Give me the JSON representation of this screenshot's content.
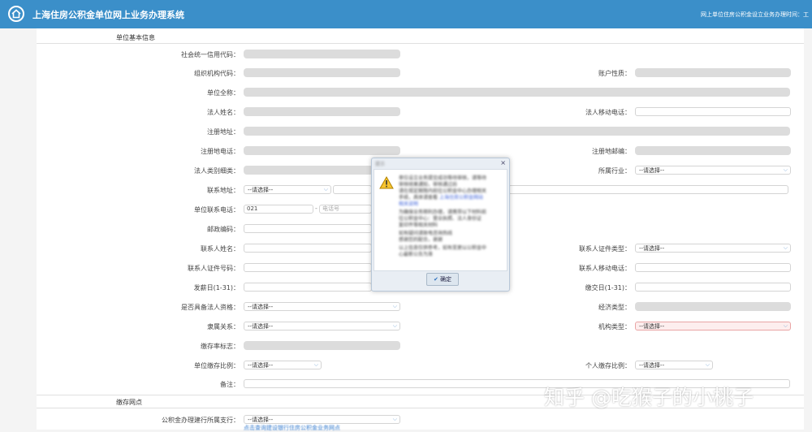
{
  "header": {
    "title": "上海住房公积金单位网上业务办理系统",
    "notice": "网上单位住房公积金设立业务办理时间：工"
  },
  "sections": {
    "basic_info": "单位基本信息",
    "deposit_point": "缴存网点"
  },
  "fields": {
    "credit_code": "社会统一信用代码：",
    "org_code": "组织机构代码：",
    "account_type": "账户性质：",
    "company_name": "单位全称：",
    "legal_name": "法人姓名：",
    "legal_mobile": "法人移动电话：",
    "reg_address": "注册地址：",
    "reg_phone": "注册地电话：",
    "reg_postcode": "注册地邮编：",
    "legal_type": "法人类别细类：",
    "industry": "所属行业：",
    "contact_address": "联系地址：",
    "company_phone": "单位联系电话：",
    "postcode": "邮政编码：",
    "contact_name": "联系人姓名：",
    "contact_id_type": "联系人证件类型：",
    "contact_id_no": "联系人证件号码：",
    "contact_mobile": "联系人移动电话：",
    "payday": "发薪日(1-31)：",
    "deposit_day": "缴交日(1-31)：",
    "legal_qualification": "是否具备法人资格：",
    "economic_type": "经济类型：",
    "affiliation": "隶属关系：",
    "org_type": "机构类型：",
    "deposit_rate_flag": "缴存率标志：",
    "company_rate": "单位缴存比例：",
    "personal_rate": "个人缴存比例：",
    "remark": "备注：",
    "bank_branch": "公积金办理建行所属支行："
  },
  "values": {
    "select_placeholder": "--请选择--",
    "area_code": "021",
    "phone_placeholder": "电话号",
    "dash": "-"
  },
  "dialog": {
    "title": "提示",
    "close": "×",
    "lines": [
      "单位设立业务提交成功等待审核，请等待",
      "审核结果通知，审核通过后",
      "请在规定期限内前往公积金中心办理相关",
      "手续，具体请查看",
      "上海住房公积金网站",
      "相关说明",
      "为确保业务顺利办理，请携带以下材料前",
      "往公积金中心：营业执照、法人身份证",
      "复印件等相关材料",
      "如有疑问请致电咨询热线",
      "感谢您的配合，谢谢",
      "以上信息仅供参考，如有变更以公积金中",
      "心最新公告为准"
    ],
    "ok": "确定"
  },
  "bottom_link": "点击查询建设银行住房公积金业务网点",
  "watermark": "知乎 @吃猴子的小桃子",
  "colors": {
    "topbar": "#3b8fc9",
    "readonly": "#dcdcdc",
    "required": "#fdeeee"
  }
}
